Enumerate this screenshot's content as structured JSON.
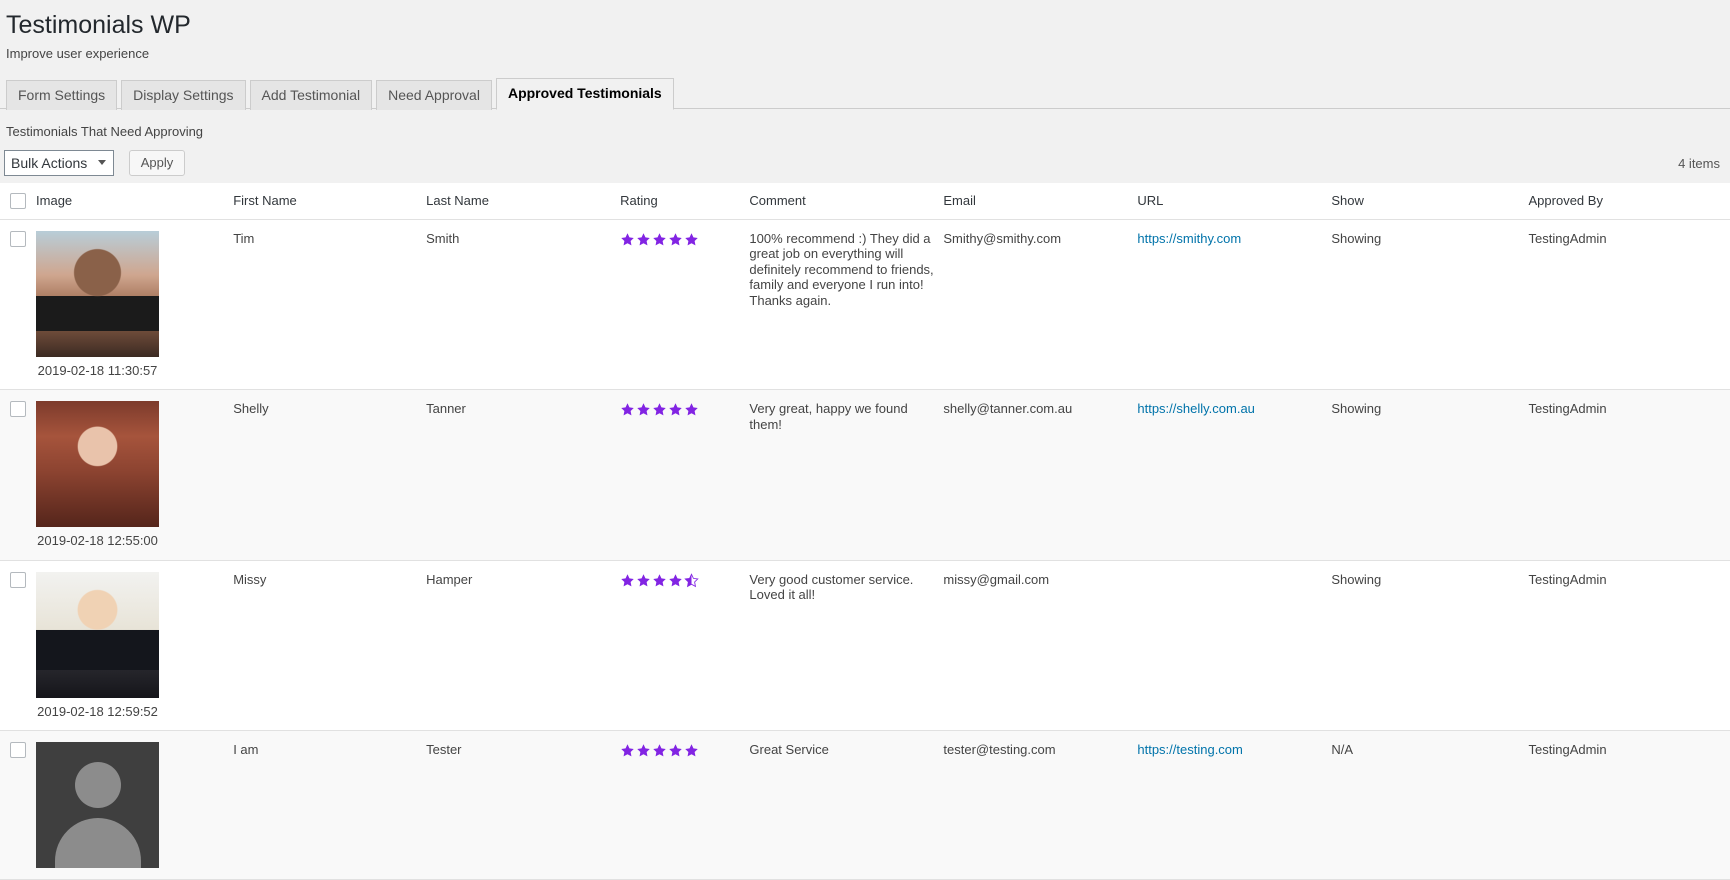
{
  "header": {
    "title": "Testimonials WP",
    "subtitle": "Improve user experience"
  },
  "tabs": [
    {
      "label": "Form Settings",
      "active": false
    },
    {
      "label": "Display Settings",
      "active": false
    },
    {
      "label": "Add Testimonial",
      "active": false
    },
    {
      "label": "Need Approval",
      "active": false
    },
    {
      "label": "Approved Testimonials",
      "active": true
    }
  ],
  "section_note": "Testimonials That Need Approving",
  "toolbar": {
    "bulk_actions_label": "Bulk Actions",
    "apply_label": "Apply",
    "items_count": "4 items"
  },
  "table": {
    "columns": [
      "Image",
      "First Name",
      "Last Name",
      "Rating",
      "Comment",
      "Email",
      "URL",
      "Show",
      "Approved By"
    ],
    "rows": [
      {
        "image_time": "2019-02-18 11:30:57",
        "image_kind": "photo-man",
        "first_name": "Tim",
        "last_name": "Smith",
        "rating": 5,
        "comment": "100% recommend :) They did a great job on everything will definitely recommend to friends, family and everyone I run into! Thanks again.",
        "email": "Smithy@smithy.com",
        "url": "https://smithy.com",
        "show": "Showing",
        "approved_by": "TestingAdmin"
      },
      {
        "image_time": "2019-02-18 12:55:00",
        "image_kind": "photo-woman-brunette",
        "first_name": "Shelly",
        "last_name": "Tanner",
        "rating": 5,
        "comment": "Very great, happy we found them!",
        "email": "shelly@tanner.com.au",
        "url": "https://shelly.com.au",
        "show": "Showing",
        "approved_by": "TestingAdmin"
      },
      {
        "image_time": "2019-02-18 12:59:52",
        "image_kind": "photo-woman-blonde",
        "first_name": "Missy",
        "last_name": "Hamper",
        "rating": 4.5,
        "comment": "Very good customer service. Loved it all!",
        "email": "missy@gmail.com",
        "url": "",
        "show": "Showing",
        "approved_by": "TestingAdmin"
      },
      {
        "image_time": "",
        "image_kind": "avatar-placeholder",
        "first_name": "I am",
        "last_name": "Tester",
        "rating": 5,
        "comment": "Great Service",
        "email": "tester@testing.com",
        "url": "https://testing.com",
        "show": "N/A",
        "approved_by": "TestingAdmin"
      }
    ]
  },
  "colors": {
    "star": "#8224e3",
    "link": "#0073aa",
    "page_bg": "#f1f1f1"
  }
}
